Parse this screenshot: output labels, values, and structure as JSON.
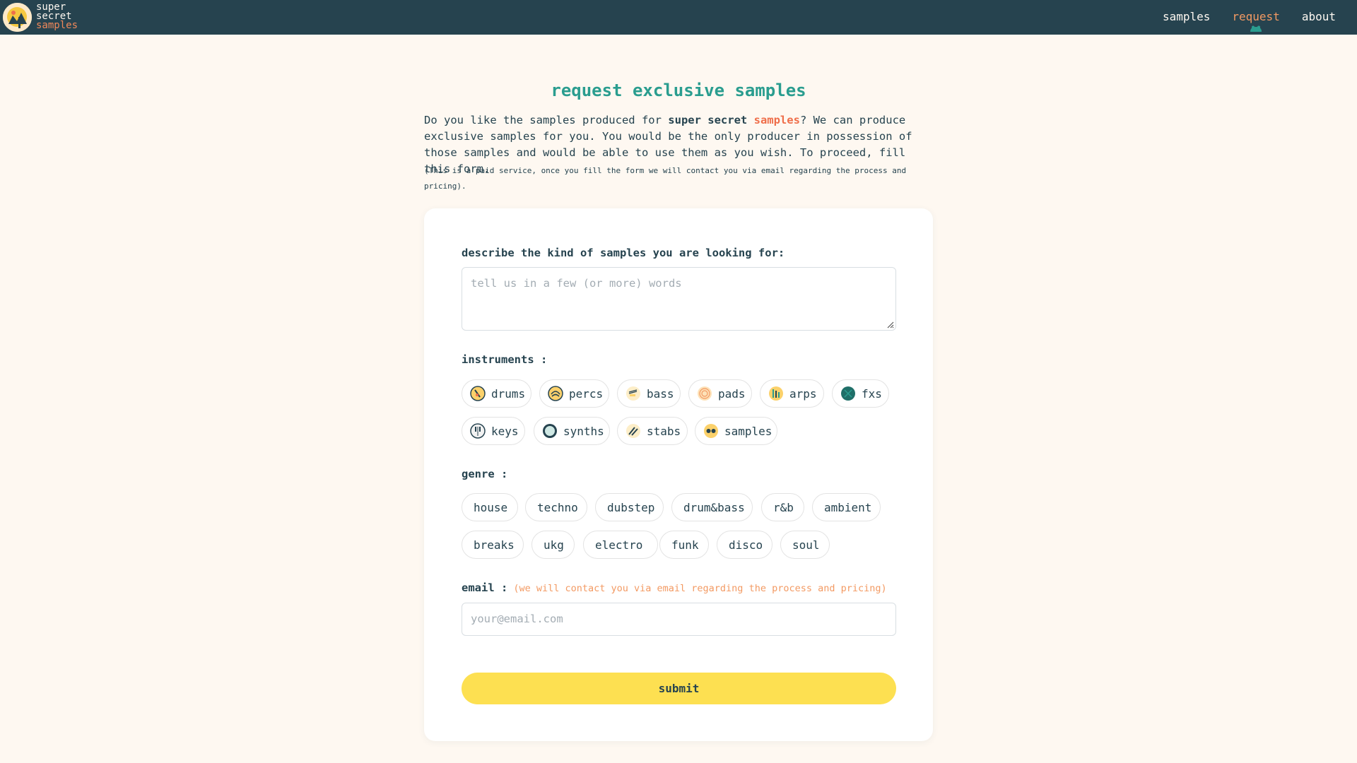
{
  "header": {
    "brand": [
      "super",
      "secret",
      "samples"
    ],
    "nav": [
      {
        "label": "samples",
        "active": false
      },
      {
        "label": "request",
        "active": true
      },
      {
        "label": "about",
        "active": false
      }
    ]
  },
  "page": {
    "title": "request exclusive samples",
    "intro": {
      "p1": "Do you like the samples produced for ",
      "brand_bold": "super secret",
      "brand_accent": "samples",
      "p2": "? We can produce exclusive samples for you. You would be the only producer in possession of those samples and would be able to use them as you wish. To proceed, fill this form."
    },
    "note": "(This is a paid service, once you fill the form we will contact you via email regarding the process and pricing)."
  },
  "form": {
    "describe": {
      "label": "describe the kind of samples you are looking for:",
      "placeholder": "tell us in a few (or more) words"
    },
    "instruments": {
      "label": "instruments :",
      "items": [
        "drums",
        "percs",
        "bass",
        "pads",
        "arps",
        "fxs",
        "keys",
        "synths",
        "stabs",
        "samples"
      ]
    },
    "genre": {
      "label": "genre :",
      "items": [
        "house",
        "techno",
        "dubstep",
        "drum&bass",
        "r&b",
        "ambient",
        "breaks",
        "ukg",
        "electro",
        "funk",
        "disco",
        "soul"
      ]
    },
    "email": {
      "label": "email :",
      "hint": "(we will contact you via email regarding the process and pricing)",
      "placeholder": "your@email.com"
    },
    "submit_label": "submit"
  },
  "colors": {
    "header_bg": "#26434f",
    "page_bg": "#fef8f1",
    "title": "#2a9d8f",
    "accent": "#ef6e4a",
    "nav_active": "#f39a63",
    "submit_bg": "#fde051"
  }
}
